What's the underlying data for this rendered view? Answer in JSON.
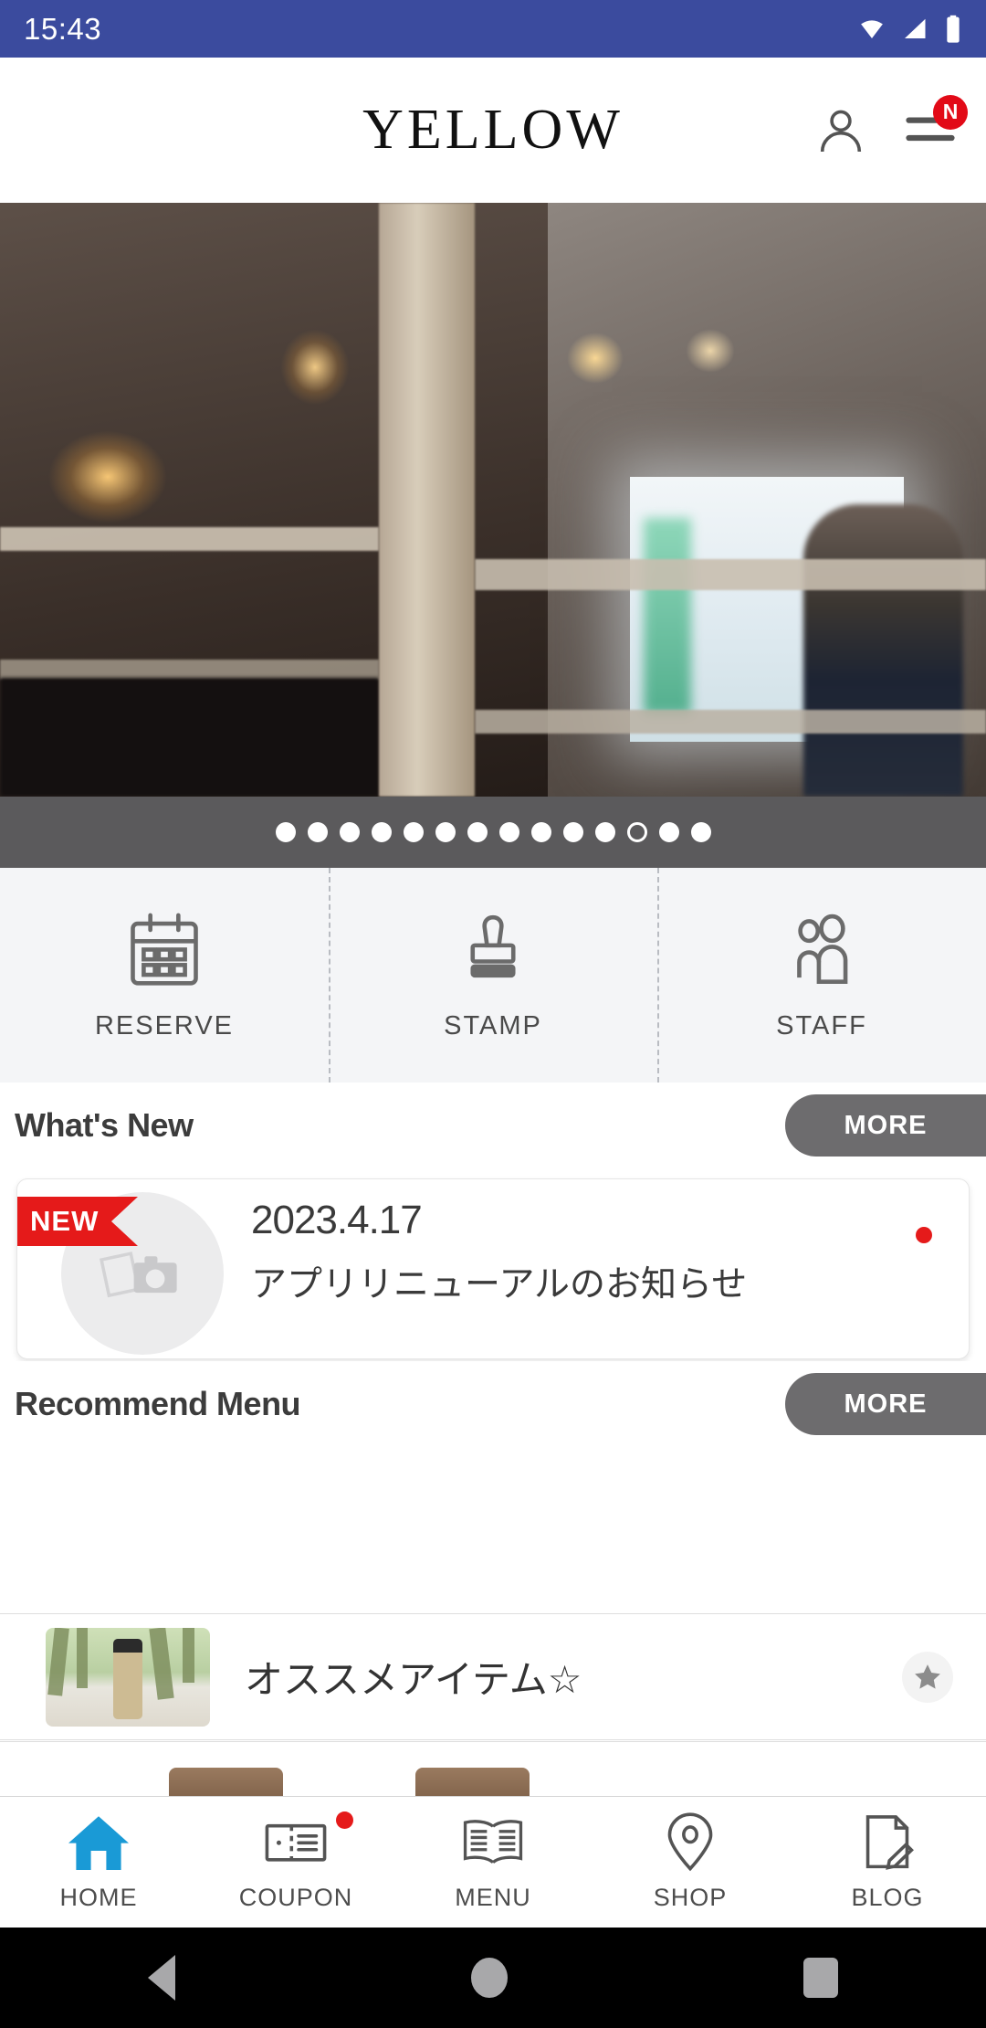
{
  "status_bar": {
    "time": "15:43",
    "icons": [
      "wifi-icon",
      "signal-icon",
      "battery-icon"
    ],
    "background_color": "#3b4b9e"
  },
  "header": {
    "brand": "YELLOW",
    "account_icon": "person-icon",
    "menu_icon": "hamburger-menu-icon",
    "menu_badge": "N",
    "badge_color": "#e20a17"
  },
  "hero": {
    "alt": "salon-interior-photo",
    "carousel": {
      "total_dots": 14,
      "active_index": 11
    }
  },
  "quick_actions": [
    {
      "label": "RESERVE",
      "icon": "calendar-icon"
    },
    {
      "label": "STAMP",
      "icon": "stamp-icon"
    },
    {
      "label": "STAFF",
      "icon": "staff-people-icon"
    }
  ],
  "whats_new": {
    "title": "What's New",
    "more_label": "MORE",
    "items": [
      {
        "badge": "NEW",
        "date": "2023.4.17",
        "title": "アプリリニューアルのお知らせ",
        "thumb_icon": "photo-placeholder-icon",
        "unread": true
      }
    ]
  },
  "recommend_menu": {
    "title": "Recommend Menu",
    "more_label": "MORE",
    "items": [
      {
        "title": "オススメアイテム☆",
        "thumb_icon": "product-photo",
        "favorite_icon": "star-icon"
      }
    ]
  },
  "bottom_nav": {
    "active": "HOME",
    "active_color": "#1a9ad6",
    "items": [
      {
        "label": "HOME",
        "icon": "home-icon",
        "badge": false
      },
      {
        "label": "COUPON",
        "icon": "coupon-icon",
        "badge": true
      },
      {
        "label": "MENU",
        "icon": "book-icon",
        "badge": false
      },
      {
        "label": "SHOP",
        "icon": "map-pin-icon",
        "badge": false
      },
      {
        "label": "BLOG",
        "icon": "blog-pen-icon",
        "badge": false
      }
    ]
  },
  "android_nav": {
    "back": "back-triangle-icon",
    "home": "home-circle-icon",
    "recents": "recents-square-icon"
  }
}
